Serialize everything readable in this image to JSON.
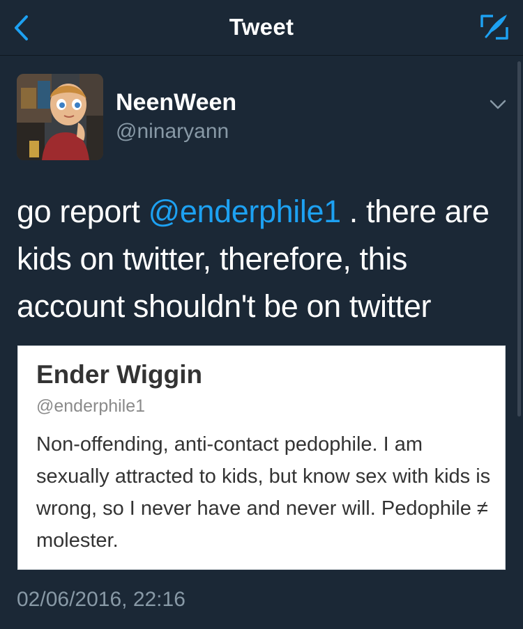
{
  "navbar": {
    "title": "Tweet",
    "back_icon": "chevron-left-icon",
    "compose_icon": "compose-icon"
  },
  "colors": {
    "background": "#1b2836",
    "accent": "#1da1f2",
    "secondary_text": "#8899a6"
  },
  "author": {
    "display_name": "NeenWeen",
    "handle": "@ninaryann"
  },
  "tweet": {
    "text_before": "go report ",
    "mention": "@enderphile1",
    "text_after": " . there are kids on twitter, therefore, this account shouldn't be on twitter",
    "timestamp": "02/06/2016, 22:16"
  },
  "media_card": {
    "name": "Ender Wiggin",
    "handle": "@enderphile1",
    "bio": "Non-offending, anti-contact pedophile. I am sexually attracted to kids, but know sex with kids is wrong, so I never have and never will. Pedophile ≠ molester."
  }
}
